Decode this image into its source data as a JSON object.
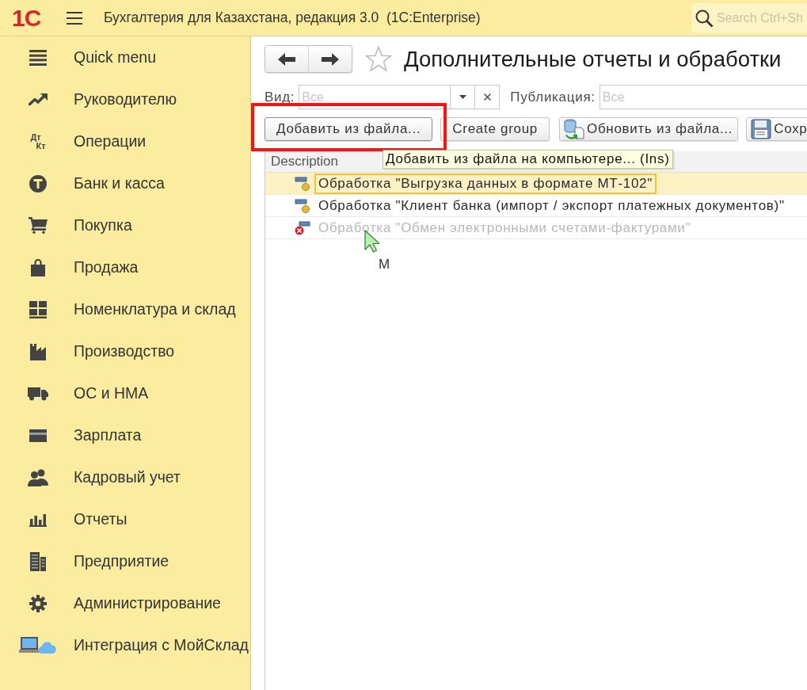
{
  "app_bar": {
    "logo": "1C",
    "title": "Бухгалтерия для Казахстана, редакция 3.0  (1C:Enterprise)",
    "search": {
      "placeholder": "Search Ctrl+Sh"
    }
  },
  "sidebar": {
    "items": [
      {
        "label": "Quick menu"
      },
      {
        "label": "Руководителю"
      },
      {
        "label": "Операции",
        "icon_text": [
          "Дт",
          "Кт"
        ]
      },
      {
        "label": "Банк и касса"
      },
      {
        "label": "Покупка"
      },
      {
        "label": "Продажа"
      },
      {
        "label": "Номенклатура и склад"
      },
      {
        "label": "Производство"
      },
      {
        "label": "ОС и НМА"
      },
      {
        "label": "Зарплата"
      },
      {
        "label": "Кадровый учет"
      },
      {
        "label": "Отчеты"
      },
      {
        "label": "Предприятие"
      },
      {
        "label": "Администрирование"
      },
      {
        "label": "Интеграция с МойСклад"
      }
    ]
  },
  "page": {
    "title": "Дополнительные отчеты и обработки",
    "favorite": false
  },
  "filters": [
    {
      "label": "Вид:",
      "placeholder": "Все",
      "kind": "choice"
    },
    {
      "label": "Публикация:",
      "placeholder": "Все",
      "kind": "text"
    }
  ],
  "toolbar": {
    "groups": [
      [
        {
          "label": "Добавить из файла...",
          "kind": "plain",
          "focused": true,
          "highlighted": true
        },
        {
          "label": "Create group",
          "kind": "plain",
          "focused": false,
          "highlighted": false
        }
      ],
      [
        {
          "label": "Обновить из файла...",
          "kind": "refresh",
          "focused": false,
          "highlighted": false
        },
        {
          "label": "Сохр",
          "kind": "save",
          "focused": false,
          "highlighted": false
        }
      ]
    ]
  },
  "tooltip": {
    "text": "Добавить из файла на компьютере... (Ins)"
  },
  "table": {
    "columns": [
      "Description"
    ],
    "rows": [
      {
        "description": "Обработка \"Выгрузка данных в формате МТ-102\"",
        "selected": true,
        "disabled": false
      },
      {
        "description": "Обработка \"Клиент банка (импорт / экспорт платежных документов)\"",
        "selected": false,
        "disabled": false
      },
      {
        "description": "Обработка \"Обмен электронными счетами-фактурами\"",
        "selected": false,
        "disabled": true
      }
    ]
  },
  "cursor_label": "M"
}
